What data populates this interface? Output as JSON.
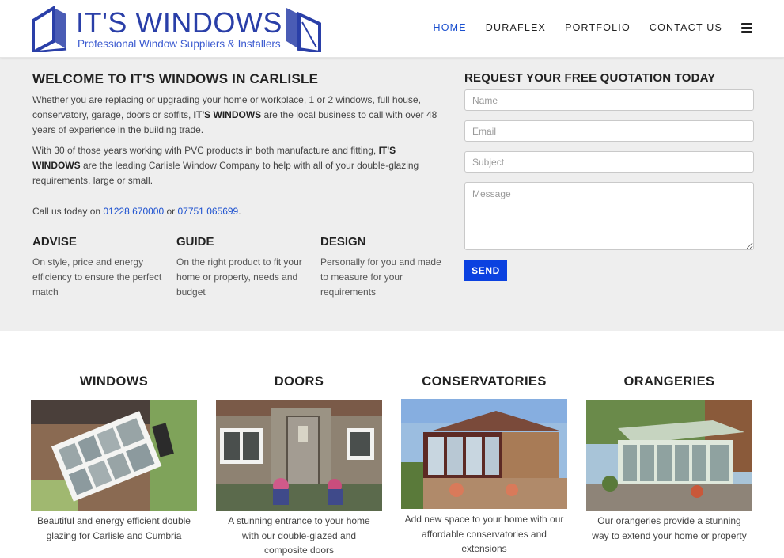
{
  "brand": {
    "logo_title": "IT'S WINDOWS",
    "logo_subtitle": "Professional Window Suppliers & Installers",
    "accent": "#1a4fcf",
    "logo_color": "#2a3fa8"
  },
  "nav": {
    "items": [
      {
        "label": "HOME",
        "active": true
      },
      {
        "label": "DURAFLEX",
        "active": false
      },
      {
        "label": "PORTFOLIO",
        "active": false
      },
      {
        "label": "CONTACT US",
        "active": false
      }
    ],
    "menu_icon": "hamburger-icon"
  },
  "intro": {
    "title": "WELCOME TO IT'S WINDOWS IN CARLISLE",
    "p1_a": "Whether you are replacing or upgrading your home or workplace, 1 or 2 windows, full house, conservatory, garage, doors or soffits, ",
    "p1_bold": "IT'S WINDOWS",
    "p1_b": " are the local business to call with over 48 years of experience in the building trade.",
    "p2_a": "With 30 of those years working with PVC products in both manufacture and fitting, ",
    "p2_bold": "IT'S WINDOWS",
    "p2_b": " are the leading Carlisle Window Company to help with all of your double-glazing requirements, large or small.",
    "call_prefix": "Call us today on ",
    "phone1": "01228 670000",
    "call_or": " or ",
    "phone2": "07751 065699",
    "call_suffix": "."
  },
  "features": [
    {
      "title": "ADVISE",
      "text": "On style, price and energy efficiency to ensure the perfect match"
    },
    {
      "title": "GUIDE",
      "text": "On the right product to fit your home or property, needs and budget"
    },
    {
      "title": "DESIGN",
      "text": "Personally for you and made to measure for your requirements"
    }
  ],
  "quote_form": {
    "title": "REQUEST YOUR FREE QUOTATION TODAY",
    "name_placeholder": "Name",
    "email_placeholder": "Email",
    "subject_placeholder": "Subject",
    "message_placeholder": "Message",
    "send_label": "SEND",
    "send_color": "#0b41e0"
  },
  "products": [
    {
      "title": "WINDOWS",
      "caption": "Beautiful and energy efficient double glazing for Carlisle and Cumbria"
    },
    {
      "title": "DOORS",
      "caption": "A stunning entrance to your home with our double-glazed and composite doors"
    },
    {
      "title": "CONSERVATORIES",
      "caption": "Add new space to your home with our affordable conservatories and extensions"
    },
    {
      "title": "ORANGERIES",
      "caption": "Our orangeries provide a stunning way to extend your home or property"
    }
  ]
}
